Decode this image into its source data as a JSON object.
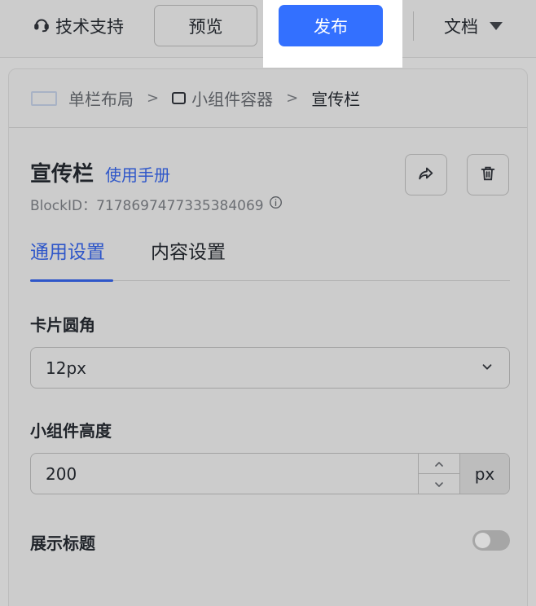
{
  "topbar": {
    "support_label": "技术支持",
    "preview_label": "预览",
    "publish_label": "发布",
    "docs_label": "文档"
  },
  "breadcrumb": {
    "items": [
      "单栏布局",
      "小组件容器",
      "宣传栏"
    ],
    "separator": ">"
  },
  "block": {
    "title": "宣传栏",
    "manual_link": "使用手册",
    "id_label": "BlockID：",
    "id_value": "7178697477335384069"
  },
  "tabs": [
    {
      "label": "通用设置",
      "active": true
    },
    {
      "label": "内容设置",
      "active": false
    }
  ],
  "settings": {
    "corner_radius": {
      "label": "卡片圆角",
      "value": "12px"
    },
    "widget_height": {
      "label": "小组件高度",
      "value": "200",
      "unit": "px"
    },
    "show_title": {
      "label": "展示标题",
      "enabled": false
    }
  },
  "colors": {
    "accent": "#3370ff",
    "link": "#2e56c9"
  },
  "icons": {
    "support": "headset-icon",
    "docs_caret": "caret-down-icon",
    "share": "share-icon",
    "delete": "trash-icon",
    "info": "info-icon",
    "select_chevron": "chevron-down-icon"
  }
}
